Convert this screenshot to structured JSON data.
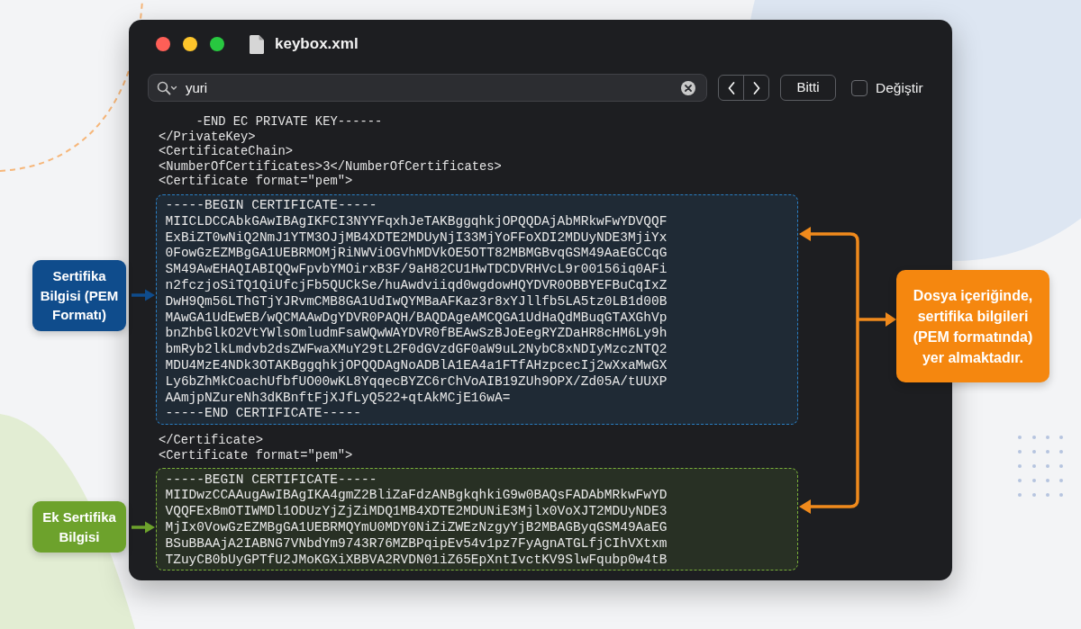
{
  "window": {
    "title": "keybox.xml"
  },
  "find_bar": {
    "search": {
      "value": "yuri"
    },
    "done_button": "Bitti",
    "replace": {
      "label": "Değiştir",
      "checked": false
    }
  },
  "code": [
    {
      "kind": "line",
      "text": "     -END EC PRIVATE KEY------"
    },
    {
      "kind": "line",
      "text": "</PrivateKey>"
    },
    {
      "kind": "line",
      "text": "<CertificateChain>"
    },
    {
      "kind": "line",
      "text": "<NumberOfCertificates>3</NumberOfCertificates>"
    },
    {
      "kind": "line",
      "text": "<Certificate format=\"pem\">"
    },
    {
      "kind": "highlight",
      "color": "#2a7fc4",
      "lines": [
        "-----BEGIN CERTIFICATE-----",
        "MIICLDCCAbkGAwIBAgIKFCI3NYYFqxhJeTAKBggqhkjOPQQDAjAbMRkwFwYDVQQF",
        "ExBiZT0wNiQ2NmJ1YTM3OJjMB4XDTE2MDUyNjI33MjYoFFoXDI2MDUyNDE3MjiYx",
        "0FowGzEZMBgGA1UEBRMOMjRiNWViOGVhMDVkOE5OTT82MBMGBvqGSM49AaEGCCqG",
        "SM49AwEHAQIABIQQwFpvbYMOirxB3F/9aH82CU1HwTDCDVRHVcL9r00156iq0AFi",
        "n2fczjoSiTQ1QiUfcjFb5QUCkSe/huAwdviiqd0wgdowHQYDVR0OBBYEFBuCqIxZ",
        "DwH9Qm56LThGTjYJRvmCMB8GA1UdIwQYMBaAFKaz3r8xYJllfb5LA5tz0LB1d00B",
        "MAwGA1UdEwEB/wQCMAAwDgYDVR0PAQH/BAQDAgeAMCQGA1UdHaQdMBuqGTAXGhVp",
        "bnZhbGlkO2VtYWlsOmludmFsaWQwWAYDVR0fBEAwSzBJoEegRYZDaHR8cHM6Ly9h",
        "bmRyb2lkLmdvb2dsZWFwaXMuY29tL2F0dGVzdGF0aW9uL2NybC8xNDIyMzczNTQ2",
        "MDU4MzE4NDk3OTAKBggqhkjOPQQDAgNoADBlA1EA4a1FTfAHzpcecIj2wXxaMwGX",
        "Ly6bZhMkCoachUfbfUO00wKL8YqqecBYZC6rChVoAIB19ZUh9OPX/Zd05A/tUUXP",
        "AAmjpNZureNh3dKBnftFjXJfLyQ522+qtAkMCjE16wA=",
        "-----END CERTIFICATE-----"
      ]
    },
    {
      "kind": "line",
      "text": "</Certificate>"
    },
    {
      "kind": "line",
      "text": "<Certificate format=\"pem\">"
    },
    {
      "kind": "highlight",
      "color": "#7ab03a",
      "lines": [
        "-----BEGIN CERTIFICATE-----",
        "MIIDwzCCAAugAwIBAgIKA4gmZ2BliZaFdzANBgkqhkiG9w0BAQsFADAbMRkwFwYD",
        "VQQFExBmOTIWMDl1ODUzYjZjZiMDQ1MB4XDTE2MDUNiE3Mjlx0VoXJT2MDUyNDE3",
        "MjIx0VowGzEZMBgGA1UEBRMQYmU0MDY0NiZiZWEzNzgyYjB2MBAGByqGSM49AaEG",
        "BSuBBAAjA2IABNG7VNbdYm9743R76MZBPqipEv54v1pz7FyAgnATGLfjCIhVXtxm",
        "TZuyCB0bUyGPTfU2JMoKGXiXBBVA2RVDN01iZ65EpXntIvctKV9SlwFqubp0w4tB"
      ]
    }
  ],
  "annotations": [
    {
      "text": "Sertifika Bilgisi (PEM Formatı)",
      "color": "#0f4c8c"
    },
    {
      "text": "Ek Sertifika Bilgisi",
      "color": "#6da22c"
    }
  ],
  "callout": {
    "text": "Dosya içeriğinde, sertifika bilgileri (PEM formatında) yer almaktadır."
  }
}
